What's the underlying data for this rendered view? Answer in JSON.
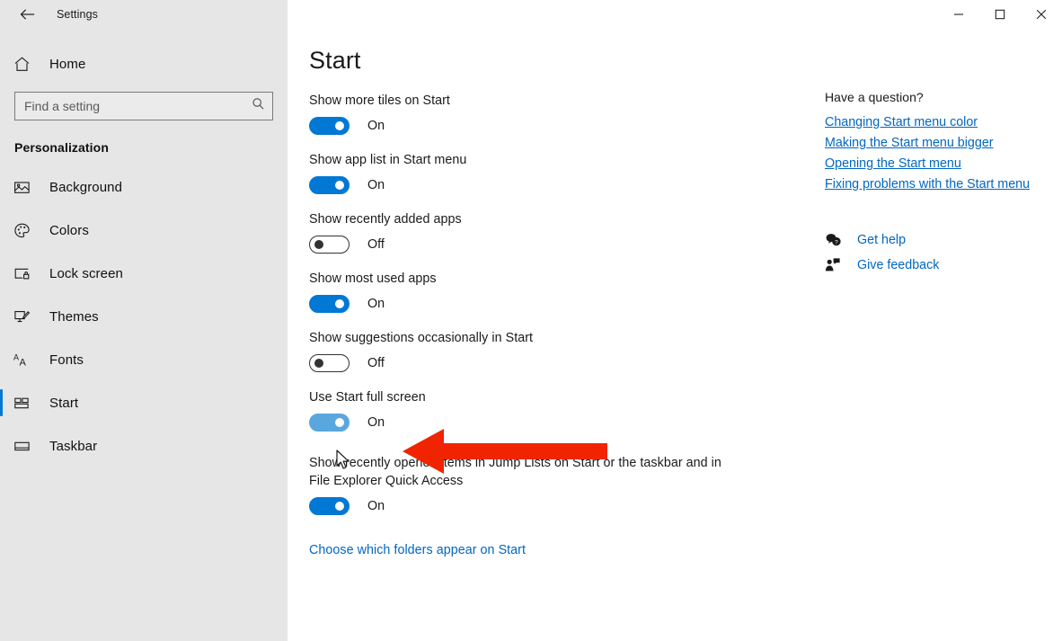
{
  "window": {
    "title": "Settings",
    "back_icon": "back-arrow-icon",
    "controls": [
      {
        "name": "minimize",
        "glyph": "minimize-icon"
      },
      {
        "name": "maximize",
        "glyph": "maximize-icon"
      },
      {
        "name": "close",
        "glyph": "close-icon"
      }
    ]
  },
  "sidebar": {
    "home": {
      "label": "Home",
      "icon": "home-icon"
    },
    "search": {
      "placeholder": "Find a setting",
      "value": "",
      "icon": "search-icon"
    },
    "category": "Personalization",
    "items": [
      {
        "label": "Background",
        "icon": "picture-icon",
        "selected": false
      },
      {
        "label": "Colors",
        "icon": "palette-icon",
        "selected": false
      },
      {
        "label": "Lock screen",
        "icon": "lock-screen-icon",
        "selected": false
      },
      {
        "label": "Themes",
        "icon": "themes-brush-icon",
        "selected": false
      },
      {
        "label": "Fonts",
        "icon": "fonts-aa-icon",
        "selected": false
      },
      {
        "label": "Start",
        "icon": "start-tiles-icon",
        "selected": true
      },
      {
        "label": "Taskbar",
        "icon": "taskbar-icon",
        "selected": false
      }
    ]
  },
  "main": {
    "page_title": "Start",
    "settings": [
      {
        "label": "Show more tiles on Start",
        "state": "On",
        "on": true,
        "hovered": false
      },
      {
        "label": "Show app list in Start menu",
        "state": "On",
        "on": true,
        "hovered": false
      },
      {
        "label": "Show recently added apps",
        "state": "Off",
        "on": false,
        "hovered": false
      },
      {
        "label": "Show most used apps",
        "state": "On",
        "on": true,
        "hovered": false
      },
      {
        "label": "Show suggestions occasionally in Start",
        "state": "Off",
        "on": false,
        "hovered": false
      },
      {
        "label": "Use Start full screen",
        "state": "On",
        "on": true,
        "hovered": true
      },
      {
        "label": "Show recently opened items in Jump Lists on Start or the taskbar and in File Explorer Quick Access",
        "state": "On",
        "on": true,
        "hovered": false
      }
    ],
    "folders_link": "Choose which folders appear on Start"
  },
  "help": {
    "heading": "Have a question?",
    "links": [
      "Changing Start menu color",
      "Making the Start menu bigger",
      "Opening the Start menu",
      "Fixing problems with the Start menu"
    ],
    "actions": [
      {
        "label": "Get help",
        "icon": "get-help-icon"
      },
      {
        "label": "Give feedback",
        "icon": "give-feedback-icon"
      }
    ]
  },
  "annotation": {
    "type": "arrow-left",
    "color": "#f02400",
    "points_at": "Use Start full screen"
  },
  "colors": {
    "accent": "#0078d4",
    "accent_hover": "#5aa7e0",
    "link": "#0067c0",
    "sidebar_bg": "#e6e6e6",
    "content_bg": "#ffffff",
    "annotation_red": "#f02400"
  }
}
